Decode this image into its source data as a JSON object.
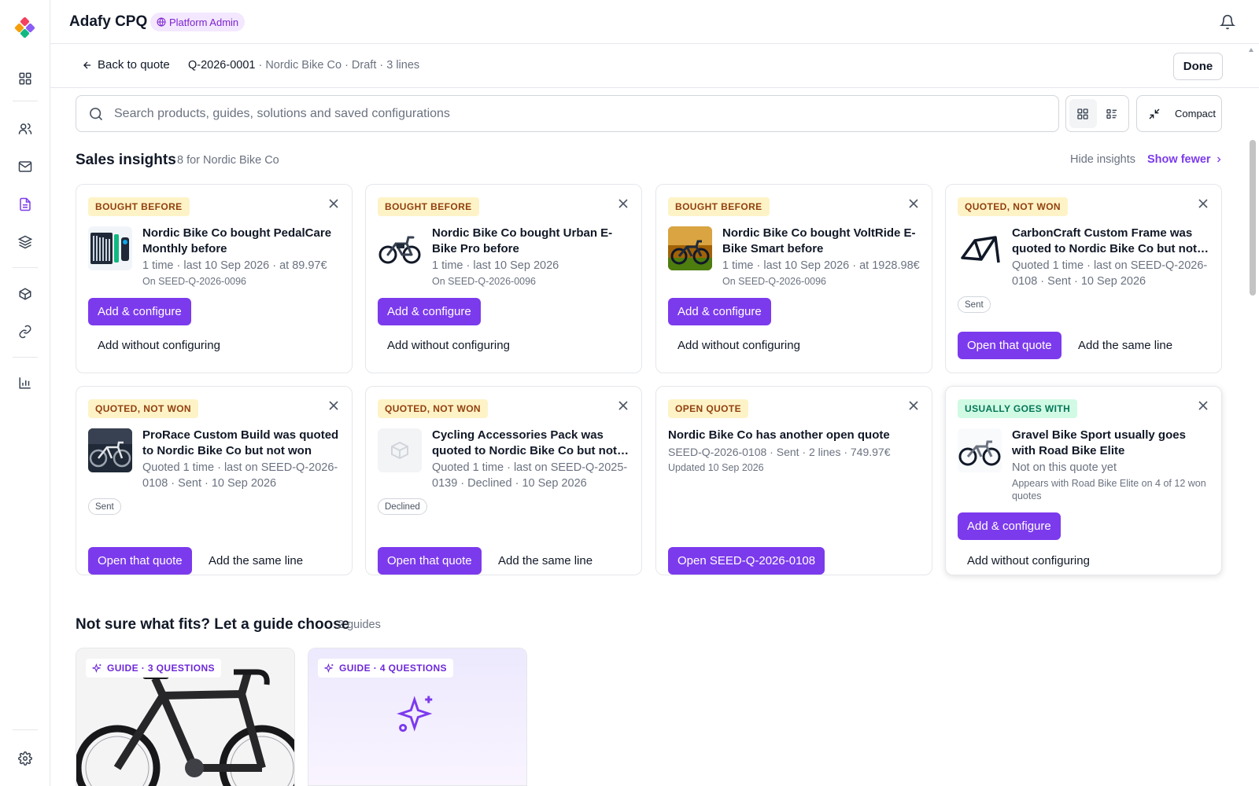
{
  "app": {
    "title": "Adafy CPQ",
    "role_badge": "Platform Admin"
  },
  "nav": {
    "icons": [
      "dashboard-icon",
      "users-icon",
      "mail-icon",
      "document-icon",
      "layers-icon",
      "package-icon",
      "link-icon",
      "chart-icon",
      "settings-icon"
    ],
    "active": "document-icon"
  },
  "context": {
    "back_label": "Back to quote",
    "quote_id": "Q-2026-0001",
    "quote_meta": " · Nordic Bike Co · Draft · 3 lines",
    "done_label": "Done"
  },
  "search": {
    "placeholder": "Search products, guides, solutions and saved configurations",
    "value": ""
  },
  "view": {
    "active": "grid",
    "compact_label": "Compact"
  },
  "insights": {
    "title": "Sales insights",
    "count": "8 for Nordic Bike Co",
    "hide_label": "Hide insights",
    "fewer_label": "Show fewer",
    "cards": [
      {
        "tag": "BOUGHT BEFORE",
        "tag_color": "#92400e",
        "thumb": "wrench-set-image",
        "title": "Nordic Bike Co bought PedalCare Monthly before",
        "line1": "1 time · last 10 Sep 2026 · at 89.97€",
        "line2": "On SEED-Q-2026-0096",
        "primary": "Add & configure",
        "secondary": "Add without configuring"
      },
      {
        "tag": "BOUGHT BEFORE",
        "tag_color": "#92400e",
        "thumb": "e-bike-image",
        "title": "Nordic Bike Co bought Urban E-Bike Pro before",
        "line1": "1 time · last 10 Sep 2026",
        "line2": "On SEED-Q-2026-0096",
        "primary": "Add & configure",
        "secondary": "Add without configuring"
      },
      {
        "tag": "BOUGHT BEFORE",
        "tag_color": "#92400e",
        "thumb": "mountain-bike-image",
        "title": "Nordic Bike Co bought VoltRide E-Bike Smart before",
        "line1": "1 time · last 10 Sep 2026 · at 1928.98€",
        "line2": "On SEED-Q-2026-0096",
        "primary": "Add & configure",
        "secondary": "Add without configuring"
      },
      {
        "tag": "QUOTED, NOT WON",
        "tag_color": "#92400e",
        "thumb": "frame-image",
        "title": "CarbonCraft Custom Frame was quoted to Nordic Bike Co but not won",
        "line1": "Quoted 1 time · last on SEED-Q-2026-0108 · Sent · 10 Sep 2026",
        "pill": "Sent",
        "primary": "Open that quote",
        "secondary": "Add the same line"
      },
      {
        "tag": "QUOTED, NOT WON",
        "tag_color": "#92400e",
        "thumb": "road-bike-image",
        "title": "ProRace Custom Build was quoted to Nordic Bike Co but not won",
        "line1": "Quoted 1 time · last on SEED-Q-2026-0108 · Sent · 10 Sep 2026",
        "pill": "Sent",
        "primary": "Open that quote",
        "secondary": "Add the same line"
      },
      {
        "tag": "QUOTED, NOT WON",
        "tag_color": "#92400e",
        "thumb": "box-placeholder-icon",
        "title": "Cycling Accessories Pack was quoted to Nordic Bike Co but not won",
        "line1": "Quoted 1 time · last on SEED-Q-2025-0139 · Declined · 10 Sep 2026",
        "pill": "Declined",
        "primary": "Open that quote",
        "secondary": "Add the same line"
      },
      {
        "tag": "OPEN QUOTE",
        "tag_color": "#92400e",
        "title": "Nordic Bike Co has another open quote",
        "line1": "SEED-Q-2026-0108 · Sent · 2 lines · 749.97€",
        "line2": "Updated 10 Sep 2026",
        "primary": "Open SEED-Q-2026-0108"
      },
      {
        "tag": "USUALLY GOES WITH",
        "tag_color": "#047857",
        "thumb": "gravel-bike-image",
        "title": "Gravel Bike Sport usually goes with Road Bike Elite",
        "line1": "Not on this quote yet",
        "line2": "Appears with Road Bike Elite on 4 of 12 won quotes",
        "primary": "Add & configure",
        "secondary": "Add without configuring"
      }
    ]
  },
  "guides": {
    "title": "Not sure what fits? Let a guide choose",
    "count": "2 guides",
    "items": [
      {
        "tag": "GUIDE · 3 QUESTIONS",
        "image": "road-bike-photo"
      },
      {
        "tag": "GUIDE · 4 QUESTIONS",
        "image": "sparkle-icon"
      }
    ]
  },
  "colors": {
    "accent": "#7c3aed",
    "badge_bg": "#f3e8ff",
    "amber_tag_bg": "#fef3c7",
    "green_tag_bg": "#d1fae5"
  }
}
